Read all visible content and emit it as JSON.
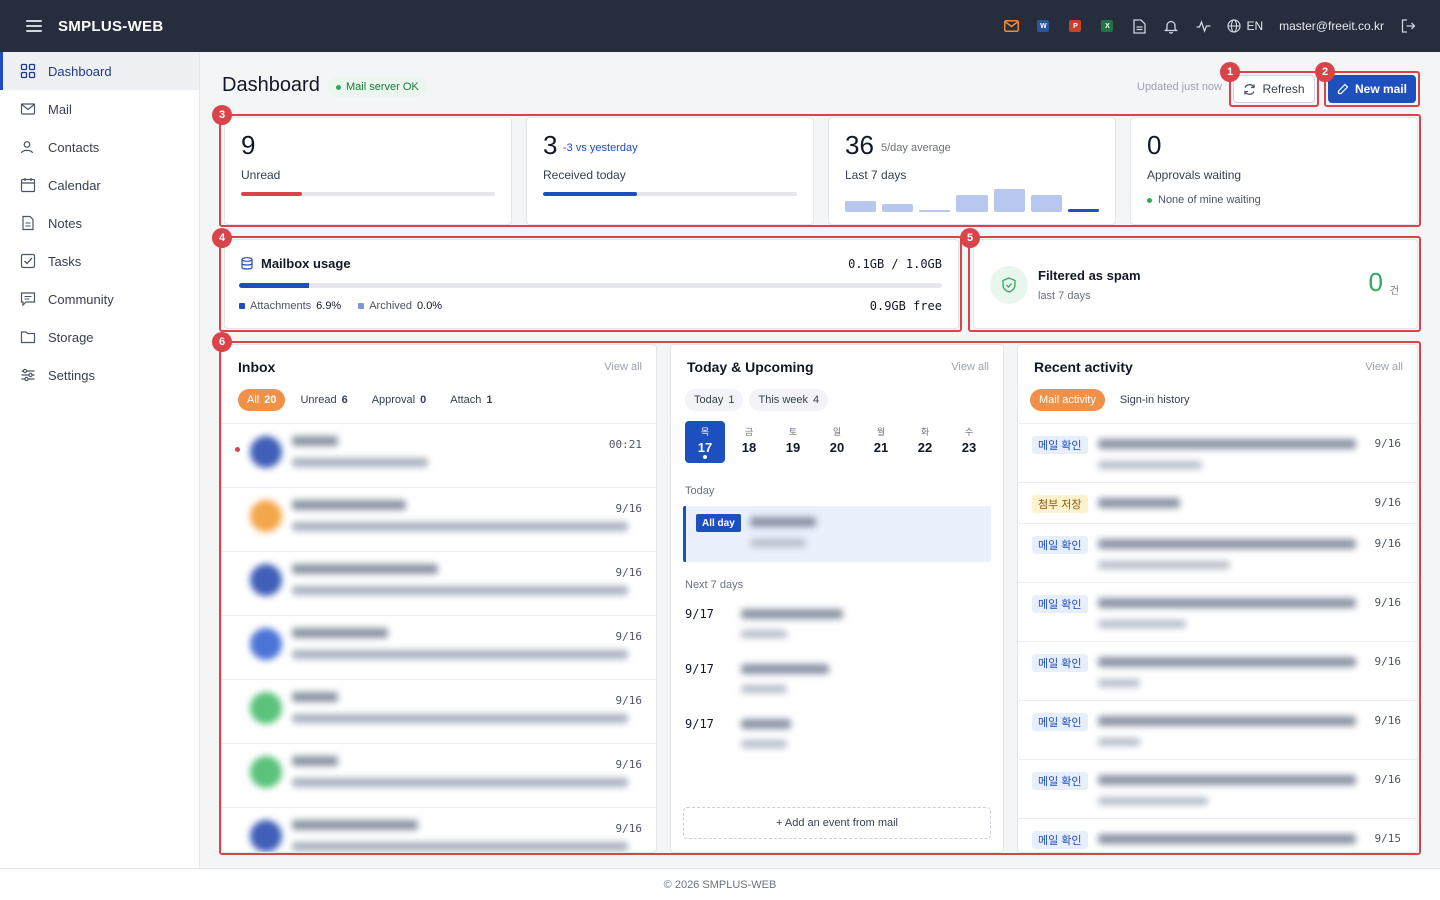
{
  "app": {
    "brand": "SMPLUS-WEB",
    "lang": "EN",
    "user": "master@freeit.co.kr",
    "footer": "© 2026 SMPLUS-WEB"
  },
  "topbar_icons": [
    "mail-icon",
    "word-icon",
    "powerpoint-icon",
    "excel-icon",
    "document-icon",
    "bell-icon",
    "activity-icon",
    "globe-icon",
    "logout-icon"
  ],
  "apps": {
    "word": "W",
    "ppt": "P",
    "excel": "X"
  },
  "sidebar": {
    "items": [
      {
        "label": "Dashboard",
        "icon": "grid-icon"
      },
      {
        "label": "Mail",
        "icon": "envelope-icon"
      },
      {
        "label": "Contacts",
        "icon": "contacts-icon"
      },
      {
        "label": "Calendar",
        "icon": "calendar-icon"
      },
      {
        "label": "Notes",
        "icon": "notes-icon"
      },
      {
        "label": "Tasks",
        "icon": "tasks-icon"
      },
      {
        "label": "Community",
        "icon": "community-icon"
      },
      {
        "label": "Storage",
        "icon": "folder-icon"
      },
      {
        "label": "Settings",
        "icon": "sliders-icon"
      }
    ]
  },
  "header": {
    "title": "Dashboard",
    "status": "Mail server OK",
    "updated": "Updated just now",
    "refresh": "Refresh",
    "new_mail": "New mail"
  },
  "badges": [
    "1",
    "2",
    "3",
    "4",
    "5",
    "6"
  ],
  "stats": {
    "unread": {
      "value": "9",
      "label": "Unread",
      "progress": 0.24,
      "color": "#d9434a"
    },
    "received": {
      "value": "3",
      "sub": "-3 vs yesterday",
      "label": "Received today",
      "progress": 0.37,
      "color": "#1e4fbf"
    },
    "last7": {
      "value": "36",
      "sub": "5/day average",
      "label": "Last 7 days",
      "spark": [
        0.45,
        0.35,
        0.06,
        0.7,
        0.95,
        0.7,
        0.12
      ]
    },
    "approvals": {
      "value": "0",
      "label": "Approvals waiting",
      "note": "None of mine waiting"
    }
  },
  "mailbox": {
    "title": "Mailbox usage",
    "usage": "0.1GB / 1.0GB",
    "progress": 0.1,
    "attachments_label": "Attachments",
    "attachments_value": "6.9%",
    "archived_label": "Archived",
    "archived_value": "0.0%",
    "free": "0.9GB free"
  },
  "spam": {
    "title": "Filtered as spam",
    "sub": "last 7 days",
    "count": "0",
    "unit": "건"
  },
  "inbox": {
    "title": "Inbox",
    "view_all": "View all",
    "tabs": [
      {
        "label": "All",
        "count": "20"
      },
      {
        "label": "Unread",
        "count": "6"
      },
      {
        "label": "Approval",
        "count": "0"
      },
      {
        "label": "Attach",
        "count": "1"
      }
    ],
    "rows": [
      {
        "time": "00:21",
        "color": "#3f5fb8",
        "unread": true,
        "w1": 46,
        "w2": 136
      },
      {
        "time": "9/16",
        "color": "#f4a74a",
        "unread": false,
        "w1": 114,
        "w2": 336
      },
      {
        "time": "9/16",
        "color": "#3f5fb8",
        "unread": false,
        "w1": 146,
        "w2": 336
      },
      {
        "time": "9/16",
        "color": "#4a74d6",
        "unread": false,
        "w1": 96,
        "w2": 336
      },
      {
        "time": "9/16",
        "color": "#5ac27a",
        "unread": false,
        "w1": 46,
        "w2": 336
      },
      {
        "time": "9/16",
        "color": "#5ac27a",
        "unread": false,
        "w1": 46,
        "w2": 336
      },
      {
        "time": "9/16",
        "color": "#3f5fb8",
        "unread": false,
        "w1": 126,
        "w2": 336
      }
    ]
  },
  "agenda": {
    "title": "Today & Upcoming",
    "view_all": "View all",
    "tabs": [
      {
        "label": "Today",
        "count": "1"
      },
      {
        "label": "This week",
        "count": "4"
      }
    ],
    "days": [
      {
        "dw": "목",
        "dn": "17"
      },
      {
        "dw": "금",
        "dn": "18"
      },
      {
        "dw": "토",
        "dn": "19"
      },
      {
        "dw": "일",
        "dn": "20"
      },
      {
        "dw": "월",
        "dn": "21"
      },
      {
        "dw": "화",
        "dn": "22"
      },
      {
        "dw": "수",
        "dn": "23"
      }
    ],
    "today_label": "Today",
    "all_day": "All day",
    "next_label": "Next 7 days",
    "upcoming": [
      {
        "date": "9/17"
      },
      {
        "date": "9/17"
      },
      {
        "date": "9/17"
      }
    ],
    "add_event": "+ Add an event from mail"
  },
  "activity": {
    "title": "Recent activity",
    "view_all": "View all",
    "tabs": [
      {
        "label": "Mail activity"
      },
      {
        "label": "Sign-in history"
      }
    ],
    "rows": [
      {
        "tag": "메일 확인",
        "kind": "blue",
        "time": "9/16",
        "w1": 258,
        "w2": 104,
        "h": 59
      },
      {
        "tag": "첨부 저장",
        "kind": "yellow",
        "time": "9/16",
        "w1": 82,
        "w2": 0,
        "h": 41
      },
      {
        "tag": "메일 확인",
        "kind": "blue",
        "time": "9/16",
        "w1": 258,
        "w2": 132,
        "h": 59
      },
      {
        "tag": "메일 확인",
        "kind": "blue",
        "time": "9/16",
        "w1": 258,
        "w2": 88,
        "h": 59
      },
      {
        "tag": "메일 확인",
        "kind": "blue",
        "time": "9/16",
        "w1": 258,
        "w2": 42,
        "h": 59
      },
      {
        "tag": "메일 확인",
        "kind": "blue",
        "time": "9/16",
        "w1": 258,
        "w2": 42,
        "h": 59
      },
      {
        "tag": "메일 확인",
        "kind": "blue",
        "time": "9/16",
        "w1": 258,
        "w2": 110,
        "h": 59
      },
      {
        "tag": "메일 확인",
        "kind": "blue",
        "time": "9/15",
        "w1": 258,
        "w2": 0,
        "h": 40
      }
    ]
  },
  "colors": {
    "accent": "#1e4fbf",
    "topbar": "#262d3d",
    "annotation": "#d9434a",
    "chip": "#f0914a",
    "ok": "#2eaa5c"
  }
}
